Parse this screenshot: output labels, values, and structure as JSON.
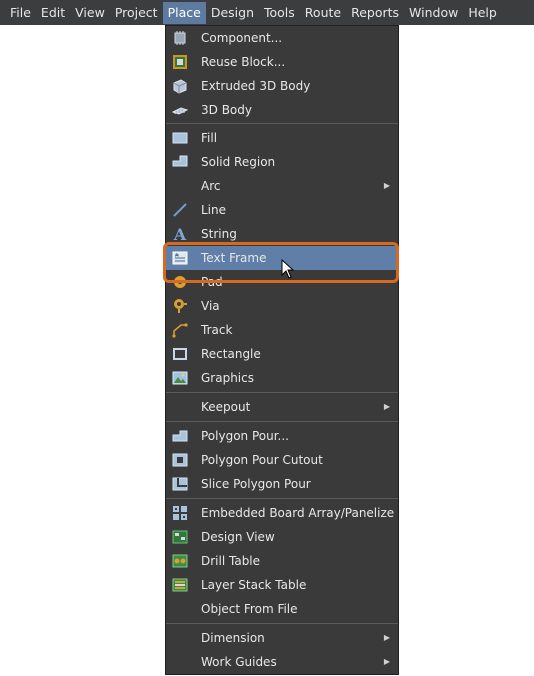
{
  "menubar": {
    "items": [
      {
        "label": "File"
      },
      {
        "label": "Edit"
      },
      {
        "label": "View"
      },
      {
        "label": "Project"
      },
      {
        "label": "Place"
      },
      {
        "label": "Design"
      },
      {
        "label": "Tools"
      },
      {
        "label": "Route"
      },
      {
        "label": "Reports"
      },
      {
        "label": "Window"
      },
      {
        "label": "Help"
      }
    ],
    "active": "Place"
  },
  "menu": {
    "items": [
      {
        "label": "Component...",
        "icon": "component-icon"
      },
      {
        "label": "Reuse Block...",
        "icon": "reuse-block-icon"
      },
      {
        "label": "Extruded 3D Body",
        "icon": "extruded-3d-body-icon"
      },
      {
        "label": "3D Body",
        "icon": "3d-body-icon"
      },
      {
        "label": "Fill",
        "icon": "fill-icon"
      },
      {
        "label": "Solid Region",
        "icon": "solid-region-icon"
      },
      {
        "label": "Arc",
        "icon": "",
        "submenu": true
      },
      {
        "label": "Line",
        "icon": "line-icon"
      },
      {
        "label": "String",
        "icon": "string-icon"
      },
      {
        "label": "Text Frame",
        "icon": "text-frame-icon",
        "highlighted": true
      },
      {
        "label": "Pad",
        "icon": "pad-icon"
      },
      {
        "label": "Via",
        "icon": "via-icon"
      },
      {
        "label": "Track",
        "icon": "track-icon"
      },
      {
        "label": "Rectangle",
        "icon": "rectangle-icon"
      },
      {
        "label": "Graphics",
        "icon": "graphics-icon"
      },
      {
        "label": "Keepout",
        "icon": "",
        "submenu": true
      },
      {
        "label": "Polygon Pour...",
        "icon": "polygon-pour-icon"
      },
      {
        "label": "Polygon Pour Cutout",
        "icon": "polygon-pour-cutout-icon"
      },
      {
        "label": "Slice Polygon Pour",
        "icon": "slice-polygon-pour-icon"
      },
      {
        "label": "Embedded Board Array/Panelize",
        "icon": "embedded-board-array-icon"
      },
      {
        "label": "Design View",
        "icon": "design-view-icon"
      },
      {
        "label": "Drill Table",
        "icon": "drill-table-icon"
      },
      {
        "label": "Layer Stack Table",
        "icon": "layer-stack-table-icon"
      },
      {
        "label": "Object From File",
        "icon": ""
      },
      {
        "label": "Dimension",
        "icon": "",
        "submenu": true
      },
      {
        "label": "Work Guides",
        "icon": "",
        "submenu": true
      }
    ]
  },
  "colors": {
    "menubar_bg": "#3c3d3f",
    "menu_bg": "#3a3a3a",
    "highlight": "#5f7fa8",
    "callout": "#d8691e"
  }
}
